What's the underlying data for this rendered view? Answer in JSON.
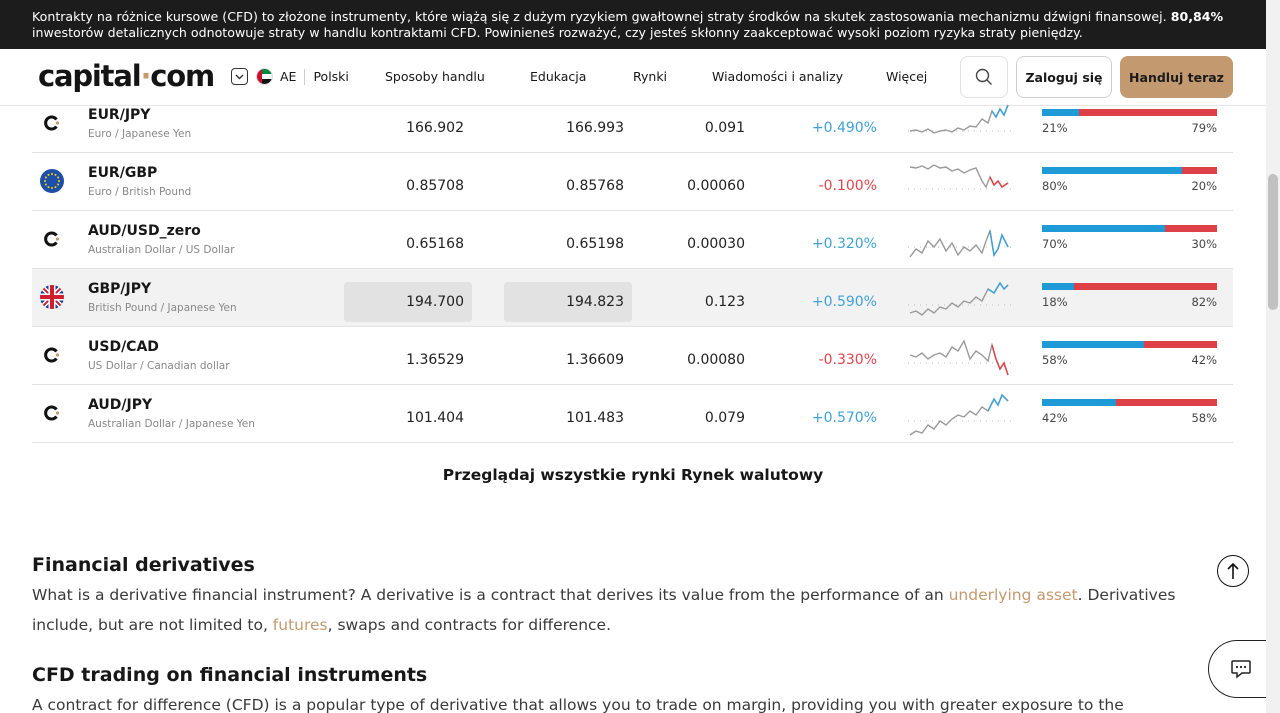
{
  "warning": {
    "text": "Kontrakty na różnice kursowe (CFD) to złożone instrumenty, które wiążą się z dużym ryzykiem gwałtownej straty środków na skutek zastosowania mechanizmu dźwigni finansowej. ",
    "percent": "80,84%",
    "text2": " inwestorów detalicznych odnotowuje straty w handlu kontraktami CFD. Powinieneś rozważyć, czy jesteś skłonny zaakceptować wysoki poziom ryzyka straty pieniędzy."
  },
  "header": {
    "logo_main": "capital",
    "logo_dot": "·",
    "logo_end": "com",
    "region_code": "AE",
    "language": "Polski",
    "nav": [
      "Sposoby handlu",
      "Edukacja",
      "Rynki",
      "Wiadomości i analizy",
      "Więcej"
    ],
    "login_label": "Zaloguj się",
    "trade_label": "Handluj teraz"
  },
  "rows": [
    {
      "name": "EUR/JPY",
      "sub": "Euro / Japanese Yen",
      "sell": "166.902",
      "buy": "166.993",
      "spread": "0.091",
      "change": "+0.490%",
      "dir": "up",
      "icon": "capital-icon",
      "buyers_pct": 21,
      "buyers": "21%",
      "sellers": "79%"
    },
    {
      "name": "EUR/GBP",
      "sub": "Euro / British Pound",
      "sell": "0.85708",
      "buy": "0.85768",
      "spread": "0.00060",
      "change": "-0.100%",
      "dir": "down",
      "icon": "eu-flag-icon",
      "buyers_pct": 80,
      "buyers": "80%",
      "sellers": "20%"
    },
    {
      "name": "AUD/USD_zero",
      "sub": "Australian Dollar / US Dollar",
      "sell": "0.65168",
      "buy": "0.65198",
      "spread": "0.00030",
      "change": "+0.320%",
      "dir": "up",
      "icon": "capital-icon",
      "buyers_pct": 70,
      "buyers": "70%",
      "sellers": "30%"
    },
    {
      "name": "GBP/JPY",
      "sub": "British Pound / Japanese Yen",
      "sell": "194.700",
      "buy": "194.823",
      "spread": "0.123",
      "change": "+0.590%",
      "dir": "up",
      "icon": "uk-flag-icon",
      "buyers_pct": 18,
      "buyers": "18%",
      "sellers": "82%"
    },
    {
      "name": "USD/CAD",
      "sub": "US Dollar / Canadian dollar",
      "sell": "1.36529",
      "buy": "1.36609",
      "spread": "0.00080",
      "change": "-0.330%",
      "dir": "down",
      "icon": "capital-icon",
      "buyers_pct": 58,
      "buyers": "58%",
      "sellers": "42%"
    },
    {
      "name": "AUD/JPY",
      "sub": "Australian Dollar / Japanese Yen",
      "sell": "101.404",
      "buy": "101.483",
      "spread": "0.079",
      "change": "+0.570%",
      "dir": "up",
      "icon": "capital-icon",
      "buyers_pct": 42,
      "buyers": "42%",
      "sellers": "58%"
    }
  ],
  "browse_label": "Przeglądaj wszystkie rynki Rynek walutowy",
  "section1": {
    "title": "Financial derivatives",
    "p1": "What is a derivative financial instrument? A derivative is a contract that derives its value from the performance of an ",
    "link1": "underlying asset",
    "p2": ". Derivatives include, but are not limited to, ",
    "link2": "futures",
    "p3": ", swaps and contracts for difference."
  },
  "section2": {
    "title": "CFD trading on financial instruments",
    "p1": "A contract for difference (CFD) is a popular type of derivative that allows you to trade on margin, providing you with greater exposure to the"
  },
  "colors": {
    "accent": "#c39a6f",
    "up": "#3fa2d7",
    "down": "#e0454b",
    "buyers": "#1e9bd7",
    "sellers": "#de4048"
  }
}
